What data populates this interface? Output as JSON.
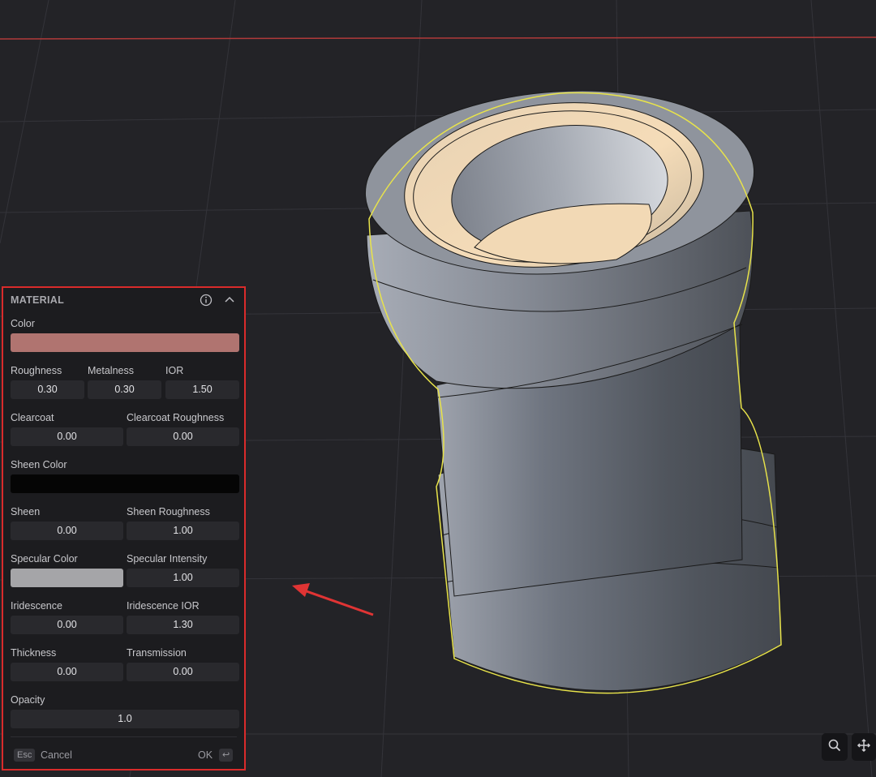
{
  "panel": {
    "title": "MATERIAL",
    "color_label": "Color",
    "color_value": "#b07470",
    "roughness_label": "Roughness",
    "roughness": "0.30",
    "metalness_label": "Metalness",
    "metalness": "0.30",
    "ior_label": "IOR",
    "ior": "1.50",
    "clearcoat_label": "Clearcoat",
    "clearcoat": "0.00",
    "clearcoat_roughness_label": "Clearcoat Roughness",
    "clearcoat_roughness": "0.00",
    "sheen_color_label": "Sheen Color",
    "sheen_color_value": "#050505",
    "sheen_label": "Sheen",
    "sheen": "0.00",
    "sheen_roughness_label": "Sheen Roughness",
    "sheen_roughness": "1.00",
    "specular_color_label": "Specular Color",
    "specular_color_value": "#a5a5a8",
    "specular_intensity_label": "Specular Intensity",
    "specular_intensity": "1.00",
    "iridescence_label": "Iridescence",
    "iridescence": "0.00",
    "iridescence_ior_label": "Iridescence IOR",
    "iridescence_ior": "1.30",
    "thickness_label": "Thickness",
    "thickness": "0.00",
    "transmission_label": "Transmission",
    "transmission": "0.00",
    "opacity_label": "Opacity",
    "opacity": "1.0"
  },
  "footer": {
    "esc_key": "Esc",
    "cancel_label": "Cancel",
    "ok_label": "OK",
    "enter_key": "↩"
  },
  "icons": {
    "info": "info-icon",
    "collapse": "chevron-up-icon",
    "search": "search-icon",
    "move": "move-icon"
  },
  "colors": {
    "panel_border": "#d92b2b",
    "selection_outline": "#e8e34a",
    "model_rim": "#f2d9b5",
    "axis_line": "#b03a3a"
  }
}
